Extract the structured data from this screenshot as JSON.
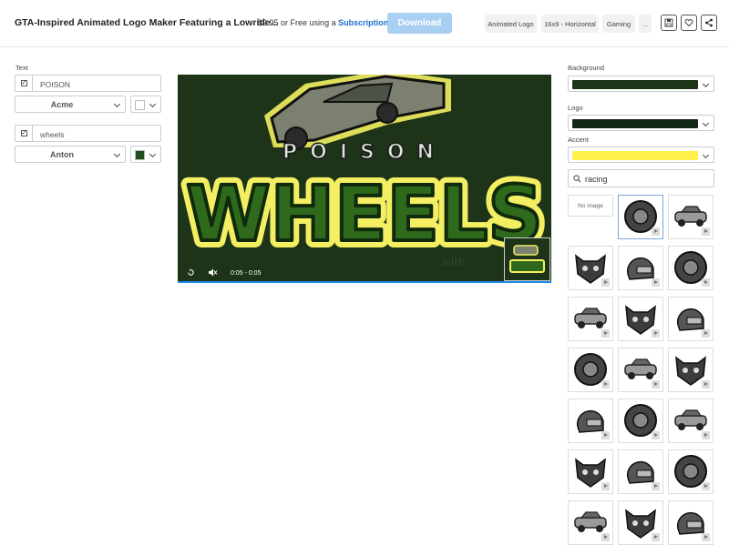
{
  "header": {
    "title": "GTA-Inspired Animated Logo Maker Featuring a Lowride...",
    "price": "$9.95",
    "price_mid": "or Free using a",
    "subscription": "Subscription",
    "download": "Download",
    "tags": [
      "Animated Logo",
      "16x9 - Horizontal",
      "Gaming",
      "..."
    ]
  },
  "left_panel": {
    "text_label": "Text",
    "fields": [
      {
        "checked": true,
        "value": "POISON",
        "font": "Acme",
        "color": "#ffffff"
      },
      {
        "checked": true,
        "value": "wheels",
        "font": "Anton",
        "color": "#1f4d1c"
      }
    ]
  },
  "video": {
    "logo_top": "POISON",
    "logo_main": "WHEELS",
    "time": "0:05 - 0:05",
    "watermark": "with",
    "progress": 1.0
  },
  "right_panel": {
    "background_label": "Background",
    "background_color": "#1d3418",
    "logo_label": "Logo",
    "logo_color": "#142818",
    "accent_label": "Accent",
    "accent_color": "#fff04a",
    "search_value": "racing",
    "no_image": "No image",
    "templates": [
      "race-car",
      "tiger",
      "panther",
      "racer",
      "sports-car",
      "classic-car",
      "crossed-pistons",
      "helmet-woman",
      "biker-helmet",
      "off-road-truck",
      "robot-mask",
      "motocross-helmet",
      "monster-face",
      "buggy-driver",
      "car-wheel",
      "wheel-racer",
      "atv-rider",
      "buggy",
      "racer-car-side",
      "trophy-car"
    ]
  },
  "colors": {
    "accent_blue": "#1e88e5",
    "download_bg": "#a9cff2",
    "logo_yellow": "#e8e04a",
    "logo_green": "#2f6a1c"
  }
}
